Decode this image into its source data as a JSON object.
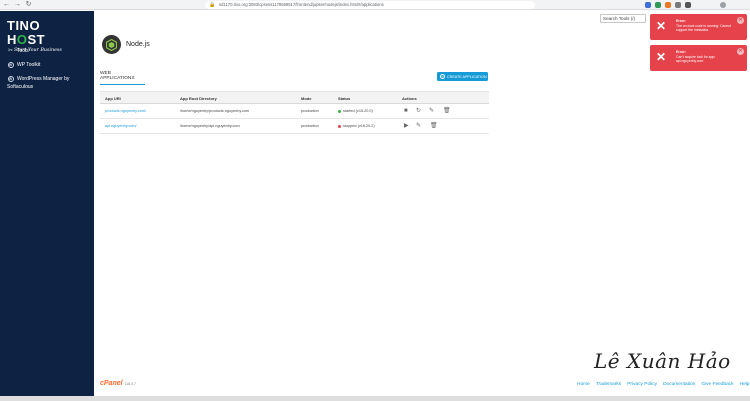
{
  "browser": {
    "url": "sd1170.tino.org:2083/cpsess1178569517/frontend/jupiter/nodejs/index.html#/applications",
    "back": "←",
    "forward": "→",
    "reload": "↻"
  },
  "brand": {
    "name_part1": "TINO H",
    "name_o": "O",
    "name_part2": "ST",
    "tagline": "Start Your Business"
  },
  "sidebar": {
    "items": [
      {
        "label": "Tools",
        "icon": "tools-icon"
      },
      {
        "label": "WP Toolkit",
        "icon": "wordpress-icon"
      },
      {
        "label": "WordPress Manager by",
        "label2": "Softaculous",
        "icon": "wordpress-icon"
      }
    ]
  },
  "header": {
    "search_placeholder": "Search Tools (/)"
  },
  "page": {
    "title": "Node.js",
    "tab_label": "WEB APPLICATIONS",
    "create_button": "CREATE APPLICATION"
  },
  "table": {
    "columns": [
      "App URI",
      "App Root Directory",
      "Mode",
      "Status",
      "Actions"
    ],
    "rows": [
      {
        "uri": "products.nguyenhy.com/",
        "root": "/home/nguyenhy/products.nguyenhy.com",
        "mode": "production",
        "status": "started (v15.20.0)",
        "status_color": "#3bb54a"
      },
      {
        "uri": "api.nguyenhy.com/",
        "root": "/home/nguyenhy/api.nguyenhy.com",
        "mode": "production",
        "status": "stopped (v16.20.2)",
        "status_color": "#e6424b"
      }
    ]
  },
  "toasts": [
    {
      "title": "Error:",
      "message": "The on-boot code is running: Cannot support the metadata."
    },
    {
      "title": "Error:",
      "message": "Can't acquire lock for app: api.nguyenhy.com"
    }
  ],
  "footer": {
    "brand": "cPanel",
    "version": "118.0.7",
    "links": [
      "Home",
      "Trademarks",
      "Privacy Policy",
      "Documentation",
      "Give Feedback",
      "Help"
    ]
  },
  "signature": "Lê Xuân Hảo",
  "colors": {
    "sidebar_bg": "#0e2344",
    "accent": "#179bd7",
    "error": "#e6424b",
    "brand_green": "#2fb34a",
    "cpanel_orange": "#ff6c2c"
  }
}
